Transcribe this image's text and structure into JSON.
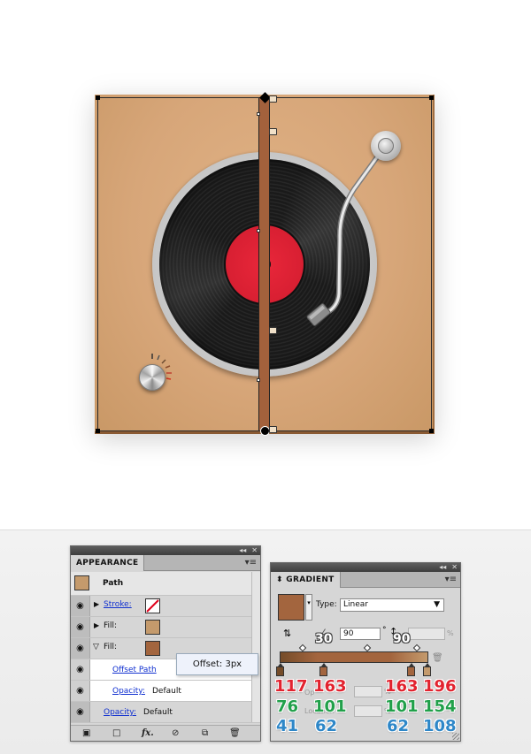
{
  "appearance": {
    "tab_label": "APPEARANCE",
    "object_label": "Path",
    "object_swatch": "#c49a6c",
    "rows": [
      {
        "label": "Stroke:",
        "link": true
      },
      {
        "label": "Fill:",
        "link": false,
        "swatch": "#c49a6c"
      },
      {
        "label": "Fill:",
        "link": false,
        "swatch": "#a3653e"
      }
    ],
    "offset_path": "Offset Path",
    "opacity_label": "Opacity:",
    "opacity_value": "Default",
    "opacity_label_2": "Opacity:",
    "opacity_value_2": "Default",
    "tooltip": "Offset: 3px"
  },
  "gradient": {
    "tab_label": "GRADIENT",
    "type_label": "Type:",
    "type_value": "Linear",
    "angle_value": "90",
    "angle_unit": "°",
    "aspect_unit": "%",
    "opacity_label": "Op",
    "location_label": "Location",
    "percent": "%",
    "swatch_color": "#a3653e",
    "stop_colors": [
      "#754c29",
      "#a3653e",
      "#a3653e",
      "#c49a6c"
    ],
    "overlay_angle_1": "30",
    "overlay_angle_2": "90"
  },
  "rgb_values": {
    "stop1": {
      "r": "117",
      "g": "76",
      "b": "41"
    },
    "stop2": {
      "r": "163",
      "g": "101",
      "b": "62"
    },
    "stop3": {
      "r": "163",
      "g": "101",
      "b": "62"
    },
    "stop4": {
      "r": "196",
      "g": "154",
      "b": "108"
    }
  },
  "colors": {
    "base": "#d7a679",
    "record_label": "#d81f32",
    "brown_path": "#a3613c"
  }
}
